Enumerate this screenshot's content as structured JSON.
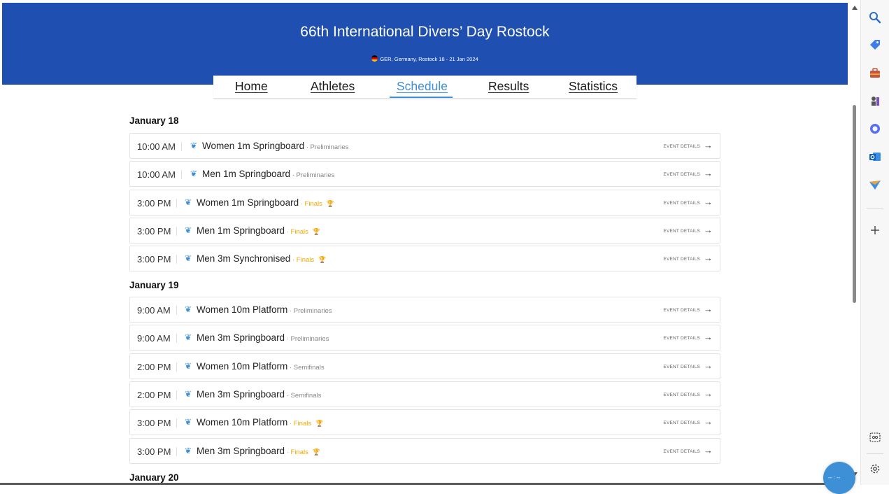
{
  "event": {
    "title": "66th International Divers’   Day Rostock",
    "subtitle": "GER, Germany, Rostock 18 - 21 Jan 2024",
    "flag_icon": "germany-flag-icon"
  },
  "nav": {
    "items": [
      {
        "label": "Home",
        "active": false
      },
      {
        "label": "Athletes",
        "active": false
      },
      {
        "label": "Schedule",
        "active": true
      },
      {
        "label": "Results",
        "active": false
      },
      {
        "label": "Statistics",
        "active": false
      }
    ]
  },
  "schedule": {
    "details_label": "EVENT DETAILS",
    "days": [
      {
        "date": "January 18",
        "events": [
          {
            "time": "10:00 AM",
            "name": "Women 1m Springboard",
            "phase": "Preliminaries",
            "final": false
          },
          {
            "time": "10:00 AM",
            "name": "Men 1m Springboard",
            "phase": "Preliminaries",
            "final": false
          },
          {
            "time": "3:00 PM",
            "name": "Women 1m Springboard",
            "phase": "Finals",
            "final": true
          },
          {
            "time": "3:00 PM",
            "name": "Men 1m Springboard",
            "phase": "Finals",
            "final": true
          },
          {
            "time": "3:00 PM",
            "name": "Men 3m Synchronised",
            "phase": "Finals",
            "final": true
          }
        ]
      },
      {
        "date": "January 19",
        "events": [
          {
            "time": "9:00 AM",
            "name": "Women 10m Platform",
            "phase": "Preliminaries",
            "final": false
          },
          {
            "time": "9:00 AM",
            "name": "Men 3m Springboard",
            "phase": "Preliminaries",
            "final": false
          },
          {
            "time": "2:00 PM",
            "name": "Women 10m Platform",
            "phase": "Semifinals",
            "final": false
          },
          {
            "time": "2:00 PM",
            "name": "Men 3m Springboard",
            "phase": "Semifinals",
            "final": false
          },
          {
            "time": "3:00 PM",
            "name": "Women 10m Platform",
            "phase": "Finals",
            "final": true
          },
          {
            "time": "3:00 PM",
            "name": "Men 3m Springboard",
            "phase": "Finals",
            "final": true
          }
        ]
      },
      {
        "date": "January 20",
        "events": []
      }
    ]
  },
  "colors": {
    "hero": "#1f4fb0",
    "accent": "#3d8fd6",
    "finals": "#f0a800"
  },
  "sidebar": {
    "icons": [
      "search-icon",
      "tag-icon",
      "briefcase-icon",
      "chess-icon",
      "office-icon",
      "outlook-icon",
      "send-icon",
      "add-icon",
      "screenshot-icon",
      "settings-icon"
    ]
  },
  "fab": {
    "label": "-- : --"
  }
}
